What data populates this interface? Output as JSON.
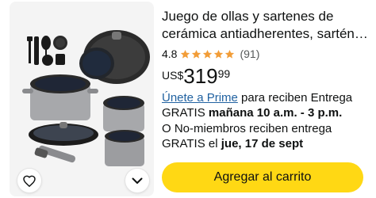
{
  "product": {
    "title": "Juego de ollas y sartenes de cerámica antiadherentes, sartén…",
    "rating": "4.8",
    "rating_count": "(91)",
    "price_currency": "US$",
    "price_whole": "319",
    "price_fraction": "99",
    "prime_link": "Únete a Prime",
    "prime_delivery_text": " para reciben Entrega GRATIS ",
    "prime_delivery_time": "mañana 10 a.m. - 3 p.m.",
    "nonmember_text": "O No-miembros reciben entrega GRATIS el ",
    "nonmember_date": "jue, 17 de sept",
    "add_to_cart": "Agregar al carrito"
  },
  "colors": {
    "star": "#f29d38",
    "link": "#2162a1",
    "button": "#ffd814"
  },
  "icons": [
    "heart-icon",
    "chevron-down-icon",
    "star-icon"
  ]
}
